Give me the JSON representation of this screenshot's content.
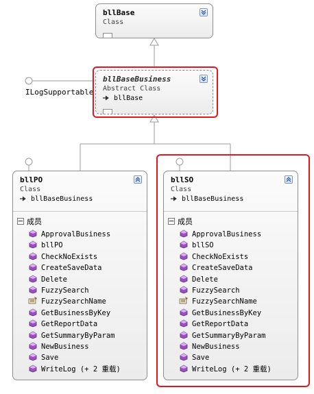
{
  "classes": {
    "bllbase": {
      "name": "bllBase",
      "type": "Class"
    },
    "bllbasebusiness": {
      "name": "bllBaseBusiness",
      "type": "Abstract Class",
      "inherits": "bllBase"
    },
    "bllpo": {
      "name": "bllPO",
      "type": "Class",
      "inherits": "bllBaseBusiness",
      "members_label": "成员",
      "members": [
        "ApprovalBusiness",
        "bllPO",
        "CheckNoExists",
        "CreateSaveData",
        "Delete",
        "FuzzySearch",
        "FuzzySearchName",
        "GetBusinessByKey",
        "GetReportData",
        "GetSummaryByParam",
        "NewBusiness",
        "Save",
        "WriteLog (+ 2 重载)"
      ]
    },
    "bllso": {
      "name": "bllSO",
      "type": "Class",
      "inherits": "bllBaseBusiness",
      "members_label": "成员",
      "members": [
        "ApprovalBusiness",
        "bllSO",
        "CheckNoExists",
        "CreateSaveData",
        "Delete",
        "FuzzySearch",
        "FuzzySearchName",
        "GetBusinessByKey",
        "GetReportData",
        "GetSummaryByParam",
        "NewBusiness",
        "Save",
        "WriteLog (+ 2 重载)"
      ]
    }
  },
  "interface": {
    "name": "ILogSupportable"
  },
  "colors": {
    "highlight": "#e8141e",
    "method_icon": "#9b4fc2",
    "property_icon": "#7a6a45"
  },
  "icons": {
    "method": "method-icon",
    "property": "property-icon",
    "inherit": "inherit-arrow-icon",
    "collapse": "collapse-icon",
    "expand": "expand-icon"
  }
}
